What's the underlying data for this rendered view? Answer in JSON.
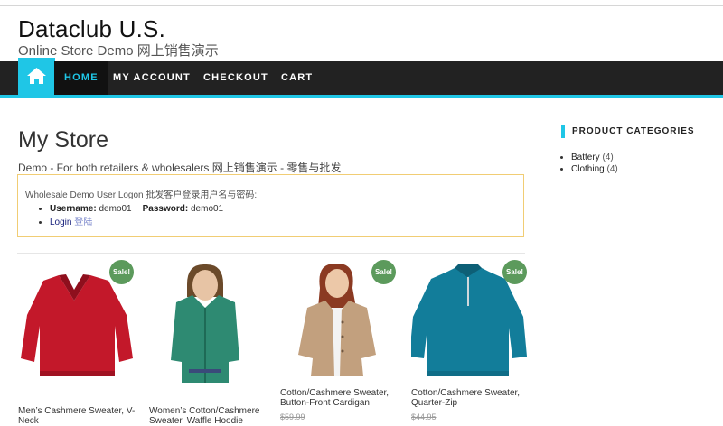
{
  "site": {
    "title": "Dataclub U.S.",
    "description": "Online Store Demo 网上销售演示"
  },
  "nav": {
    "home_icon": "home-icon",
    "items": [
      {
        "label": "HOME",
        "active": true
      },
      {
        "label": "MY ACCOUNT",
        "active": false
      },
      {
        "label": "CHECKOUT",
        "active": false
      },
      {
        "label": "CART",
        "active": false
      }
    ],
    "accent_color": "#1fc6e6",
    "background_color": "#222222"
  },
  "main": {
    "title": "My Store",
    "subtitle": "Demo - For both retailers & wholesalers 网上销售演示 - 零售与批发",
    "logon": {
      "heading": "Wholesale Demo User Logon 批发客户登录用户名与密码:",
      "username_label": "Username:",
      "username": "demo01",
      "password_label": "Password:",
      "password": "demo01",
      "login_label": "Login",
      "login_cn": "登陆"
    }
  },
  "products": [
    {
      "name": "Men’s Cashmere Sweater, V-Neck",
      "sale_label": "Sale!",
      "on_sale": true,
      "old_price": "",
      "color": "#c3182a",
      "image": "red-v-neck-sweater"
    },
    {
      "name": "Women’s Cotton/Cashmere Sweater, Waffle Hoodie",
      "sale_label": "",
      "on_sale": false,
      "old_price": "",
      "color": "#2e8a72",
      "image": "green-waffle-hoodie"
    },
    {
      "name": "Cotton/Cashmere Sweater, Button-Front Cardigan",
      "sale_label": "Sale!",
      "on_sale": true,
      "old_price": "$59.99",
      "color": "#c2a07e",
      "image": "tan-cardigan"
    },
    {
      "name": "Cotton/Cashmere Sweater, Quarter-Zip",
      "sale_label": "Sale!",
      "on_sale": true,
      "old_price": "$44.95",
      "color": "#127d9a",
      "image": "teal-quarter-zip"
    }
  ],
  "sidebar": {
    "heading": "PRODUCT CATEGORIES",
    "categories": [
      {
        "label": "Battery",
        "count": "(4)"
      },
      {
        "label": "Clothing",
        "count": "(4)"
      }
    ]
  },
  "colors": {
    "sale_badge": "#5c9a5c",
    "logon_border": "#f1cd74"
  }
}
